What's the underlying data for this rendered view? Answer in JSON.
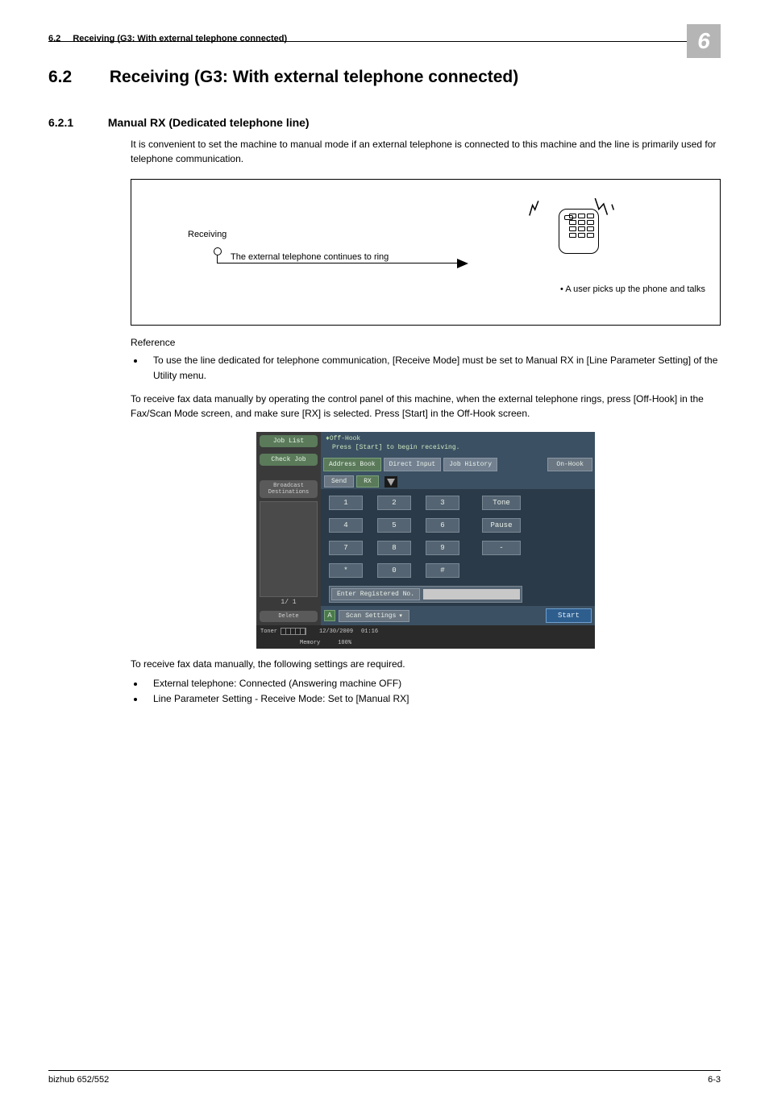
{
  "chapter_badge": "6",
  "running_header": {
    "num": "6.2",
    "title": "Receiving (G3: With external telephone connected)"
  },
  "h1": {
    "num": "6.2",
    "title": "Receiving (G3: With external telephone connected)"
  },
  "h2": {
    "num": "6.2.1",
    "title": "Manual RX (Dedicated telephone line)"
  },
  "para1": "It is convenient to set the machine to manual mode if an external telephone is connected to this machine and the line is primarily used for telephone communication.",
  "diagram": {
    "receiving": "Receiving",
    "ring_text": "The external telephone continues to ring",
    "caption": "• A user picks up the phone and talks"
  },
  "reference_label": "Reference",
  "reference_bullets": [
    "To use the line dedicated for telephone communication, [Receive Mode] must be set to Manual RX in [Line Parameter Setting] of the Utility menu."
  ],
  "para2": "To receive fax data manually by operating the control panel of this machine, when the external telephone rings, press [Off-Hook] in the Fax/Scan Mode screen, and make sure [RX] is selected. Press [Start] in the Off-Hook screen.",
  "panel": {
    "banner_title": "Off-Hook",
    "banner_sub": "Press [Start] to begin receiving.",
    "left": {
      "job_list": "Job List",
      "check_job": "Check Job",
      "broadcast": "Broadcast\nDestinations",
      "page": "1/  1",
      "delete": "Delete",
      "toner": "Toner"
    },
    "tabs": {
      "addr": "Address Book",
      "direct": "Direct Input",
      "history": "Job History",
      "onhook": "On-Hook"
    },
    "subtabs": {
      "send": "Send",
      "rx": "RX"
    },
    "keys": [
      "1",
      "2",
      "3",
      "4",
      "5",
      "6",
      "7",
      "8",
      "9",
      "*",
      "0",
      "#"
    ],
    "side": {
      "tone": "Tone",
      "pause": "Pause",
      "dash": "-"
    },
    "enter_reg": "Enter Registered No.",
    "scan": "Scan Settings",
    "start": "Start",
    "footer": {
      "date": "12/30/2009",
      "time": "01:16",
      "mem": "Memory",
      "pct": "100%"
    }
  },
  "para3": "To receive fax data manually, the following settings are required.",
  "settings_bullets": [
    "External telephone: Connected (Answering machine OFF)",
    "Line Parameter Setting - Receive Mode: Set to [Manual RX]"
  ],
  "footer": {
    "left": "bizhub 652/552",
    "right": "6-3"
  }
}
